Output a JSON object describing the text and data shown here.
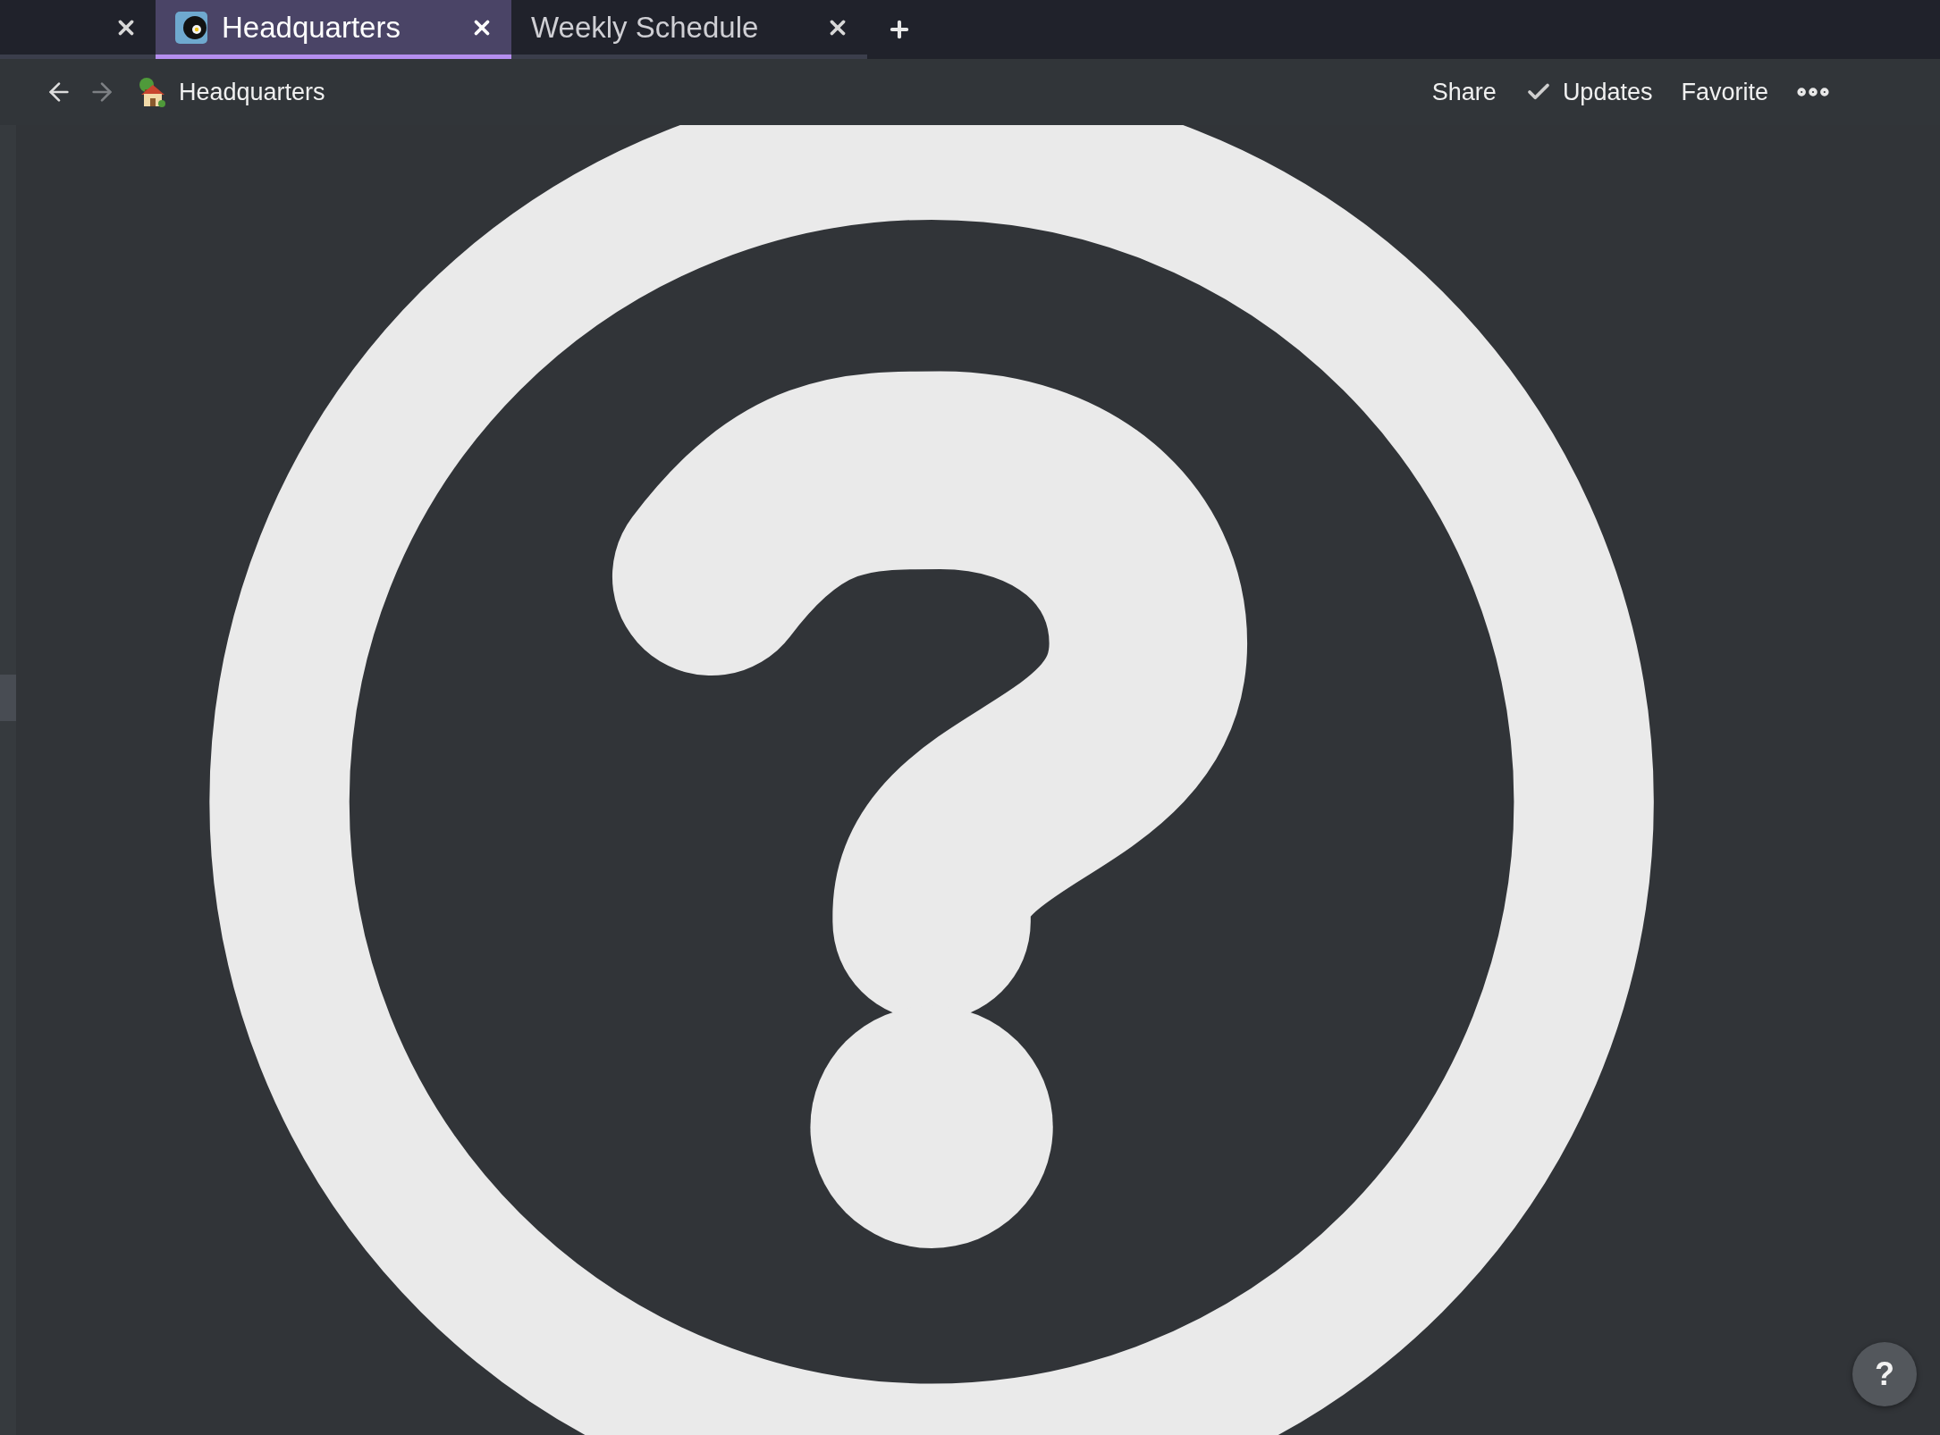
{
  "tabs": [
    {
      "favicon": false,
      "selected": false
    },
    {
      "title": "Headquarters",
      "favicon": true,
      "selected": true
    },
    {
      "title": "Weekly Schedule",
      "favicon": false,
      "selected": false
    }
  ],
  "nav": {
    "back_enabled": true,
    "forward_enabled": false
  },
  "breadcrumb": {
    "title": "Headquarters"
  },
  "actions": [
    {
      "label": "Share",
      "kind": "plain"
    },
    {
      "label": "Updates",
      "kind": "checked"
    },
    {
      "label": "Favorite",
      "kind": "plain"
    }
  ],
  "help_button": {
    "label": "?"
  }
}
